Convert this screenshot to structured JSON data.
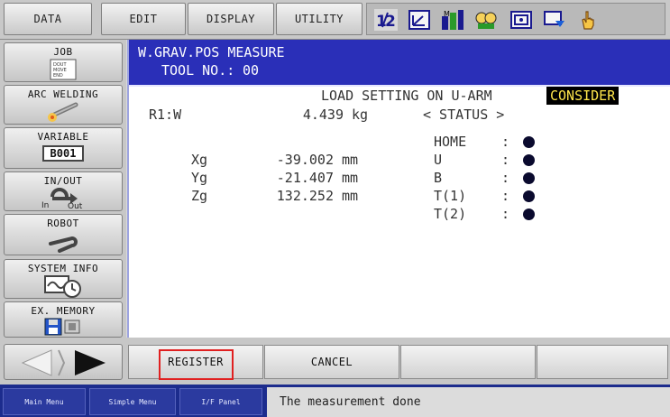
{
  "topmenu": {
    "tabs": [
      "DATA",
      "EDIT",
      "DISPLAY",
      "UTILITY"
    ]
  },
  "toolbar": {
    "icons": [
      "multi-window-icon",
      "coordinate-icon",
      "tool-icon",
      "robot-group-icon",
      "camera-icon",
      "screen-icon",
      "hand-pointer-icon"
    ]
  },
  "leftmenu": {
    "items": [
      {
        "label": "JOB",
        "icon": "job-document-icon"
      },
      {
        "label": "ARC WELDING",
        "icon": "welding-torch-icon"
      },
      {
        "label": "VARIABLE",
        "icon": "variable-icon",
        "sub": "B001"
      },
      {
        "label": "IN/OUT",
        "icon": "in-out-icon",
        "sub_in": "In",
        "sub_out": "Out"
      },
      {
        "label": "ROBOT",
        "icon": "robot-arm-icon"
      },
      {
        "label": "SYSTEM INFO",
        "icon": "system-info-icon"
      },
      {
        "label": "EX. MEMORY",
        "icon": "floppy-disk-icon"
      }
    ]
  },
  "job_icon_lines": [
    "DOUT",
    "MOVE",
    "END"
  ],
  "header": {
    "title": "W.GRAV.POS MEASURE",
    "tool_label": "TOOL NO.:",
    "tool_value": "00"
  },
  "load_setting": {
    "label": "LOAD SETTING ON U-ARM",
    "value": "CONSIDER"
  },
  "weight": {
    "label": "R1:W",
    "value": "4.439",
    "unit": "kg"
  },
  "center": [
    {
      "label": "Xg",
      "value": "-39.002",
      "unit": "mm"
    },
    {
      "label": "Yg",
      "value": "-21.407",
      "unit": "mm"
    },
    {
      "label": "Zg",
      "value": "132.252",
      "unit": "mm"
    }
  ],
  "status": {
    "title": "< STATUS >",
    "rows": [
      {
        "label": "HOME",
        "sep": ":"
      },
      {
        "label": "U",
        "sep": ":"
      },
      {
        "label": "B",
        "sep": ":"
      },
      {
        "label": "T(1)",
        "sep": ":"
      },
      {
        "label": "T(2)",
        "sep": ":"
      }
    ]
  },
  "buttons": {
    "register": "REGISTER",
    "cancel": "CANCEL"
  },
  "statusbar": {
    "tabs": [
      "Main Menu",
      "Simple Menu",
      "I/F Panel"
    ],
    "message": "The measurement done"
  },
  "colors": {
    "screen_blue": "#2b33c5",
    "highlight_bg": "#000000",
    "highlight_fg": "#ffe64b",
    "register_outline": "#e02020"
  }
}
